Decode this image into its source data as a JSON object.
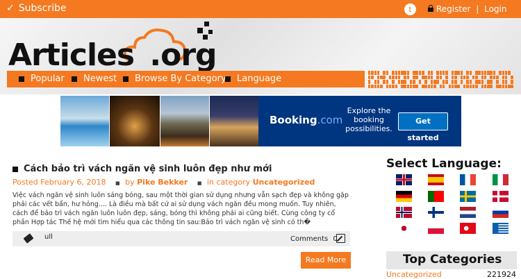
{
  "topbar": {
    "subscribe_label": "Subscribe",
    "register_label": "Register",
    "separator": "|",
    "login_label": "Login",
    "twitter_glyph": "t"
  },
  "logo": {
    "brand": "Articles",
    "tld": ".org"
  },
  "nav": {
    "items": [
      {
        "label": "Popular"
      },
      {
        "label": "Newest"
      },
      {
        "label": "Browse By Category"
      },
      {
        "label": "Language"
      }
    ]
  },
  "ad": {
    "brand": "Booking",
    "brand_suffix": ".com",
    "tagline": "Explore the booking possibilities.",
    "cta": "Get started"
  },
  "article": {
    "title": "Cách bảo trì vách ngăn vệ sinh luôn đẹp như mới",
    "posted_label": "Posted",
    "date": "February 6, 2018",
    "by_label": "by",
    "author": "Pike Bekker",
    "in_label": "in category",
    "category": "Uncategorized",
    "excerpt": "Việc vách ngăn vệ sinh luôn sáng bóng, sau một thời gian sử dụng nhưng vẫn sạch đẹp và không gặp phải các vết bẩn, hư hỏng.... Là điều mà bất cứ ai sử dụng vách ngăn đều mong muốn. Tuy nhiên, cách để bảo trì vách ngăn luôn luôn đẹp, sáng, bóng thì không phải ai cũng biết. Cùng công ty cổ phần Hợp tác Thế hệ mới tìm hiểu qua các thông tin sau:Bảo trì vách ngăn vệ sinh có th�",
    "tags": "ull",
    "comments_label": "Comments",
    "comments_count": "0",
    "read_more": "Read More"
  },
  "sidebar": {
    "language_title": "Select Language:",
    "flags": [
      {
        "name": "uk-flag-icon"
      },
      {
        "name": "spain-flag-icon"
      },
      {
        "name": "france-flag-icon"
      },
      {
        "name": "italy-flag-icon"
      },
      {
        "name": "germany-flag-icon"
      },
      {
        "name": "portugal-flag-icon"
      },
      {
        "name": "sweden-flag-icon"
      },
      {
        "name": "denmark-flag-icon"
      },
      {
        "name": "norway-flag-icon"
      },
      {
        "name": "finland-flag-icon"
      },
      {
        "name": "netherlands-flag-icon"
      },
      {
        "name": "russia-flag-icon"
      },
      {
        "name": "japan-flag-icon"
      },
      {
        "name": "poland-flag-icon"
      },
      {
        "name": "turkey-flag-icon"
      },
      {
        "name": "greece-flag-icon"
      }
    ],
    "top_categories_title": "Top Categories",
    "categories": [
      {
        "name": "Uncategorized",
        "count": "221924"
      }
    ]
  },
  "colors": {
    "accent": "#f47920",
    "booking_blue": "#003580",
    "booking_button": "#0071c2"
  }
}
